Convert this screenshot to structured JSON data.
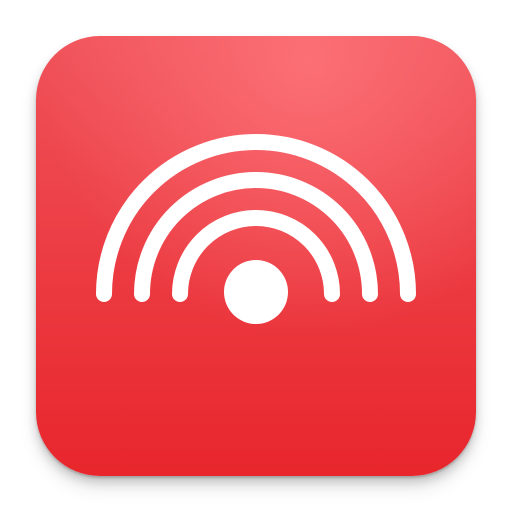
{
  "app_icon": {
    "name": "wireless-signal-app-icon",
    "symbol": "signal-broadcast-icon",
    "colors": {
      "background_top": "#f0525a",
      "background_bottom": "#e8262c",
      "highlight": "#ff7a7f",
      "glyph": "#ffffff"
    }
  }
}
